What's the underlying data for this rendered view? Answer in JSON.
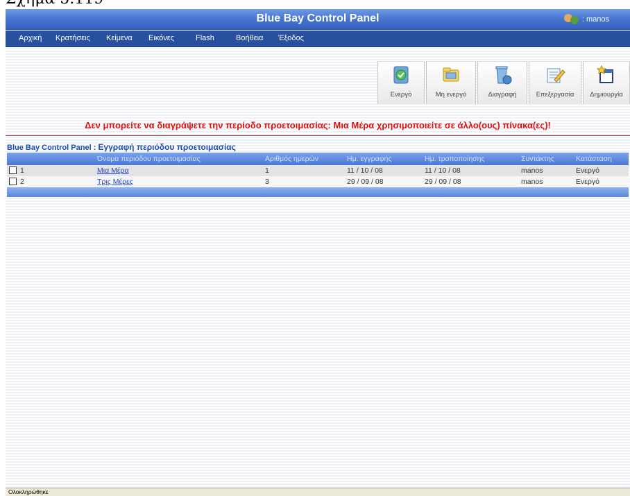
{
  "caption": "Σχήμα 5.119",
  "app": {
    "title": "Blue Bay Control Panel",
    "user_label": ": manos"
  },
  "menu": [
    "Αρχική",
    "Κρατήσεις",
    "Κείμενα",
    "Εικόνες",
    "Flash",
    "Βοήθεια",
    "Έξοδος"
  ],
  "toolbar": [
    {
      "label": "Ενεργό",
      "icon": "activate-icon"
    },
    {
      "label": "Μη ενεργό",
      "icon": "deactivate-icon"
    },
    {
      "label": "Διαγραφή",
      "icon": "delete-icon"
    },
    {
      "label": "Επεξεργασία",
      "icon": "edit-icon"
    },
    {
      "label": "Δημιουργία",
      "icon": "create-icon"
    }
  ],
  "error": "Δεν μπορείτε να διαγράψετε την περίοδο προετοιμασίας: Μια Μέρα χρησιμοποιείτε σε άλλο(ους) πίνακα(ες)!",
  "section": {
    "prefix": "Blue Bay Control Panel : ",
    "title": "Εγγραφή περιόδου προετοιμασίας"
  },
  "table": {
    "columns": [
      "Όνομα περιόδου προετοιμασίας",
      "Αριθμός ημερών",
      "Ημ. εγγραφής",
      "Ημ. τροποποίησης",
      "Συντάκτης",
      "Κατάσταση"
    ],
    "rows": [
      {
        "num": "1",
        "name": "Μια Μέρα",
        "days": "1",
        "created": "11 / 10 / 08",
        "modified": "11 / 10 / 08",
        "author": "manos",
        "status": "Ενεργό"
      },
      {
        "num": "2",
        "name": "Τρις Μέρες",
        "days": "3",
        "created": "29 / 09 / 08",
        "modified": "29 / 09 / 08",
        "author": "manos",
        "status": "Ενεργό"
      }
    ]
  },
  "status_bar": "Ολοκληρώθηκε",
  "colors": {
    "header": "#4674cf",
    "menu": "#27509f",
    "error": "#e01010",
    "link": "#2247c9"
  }
}
